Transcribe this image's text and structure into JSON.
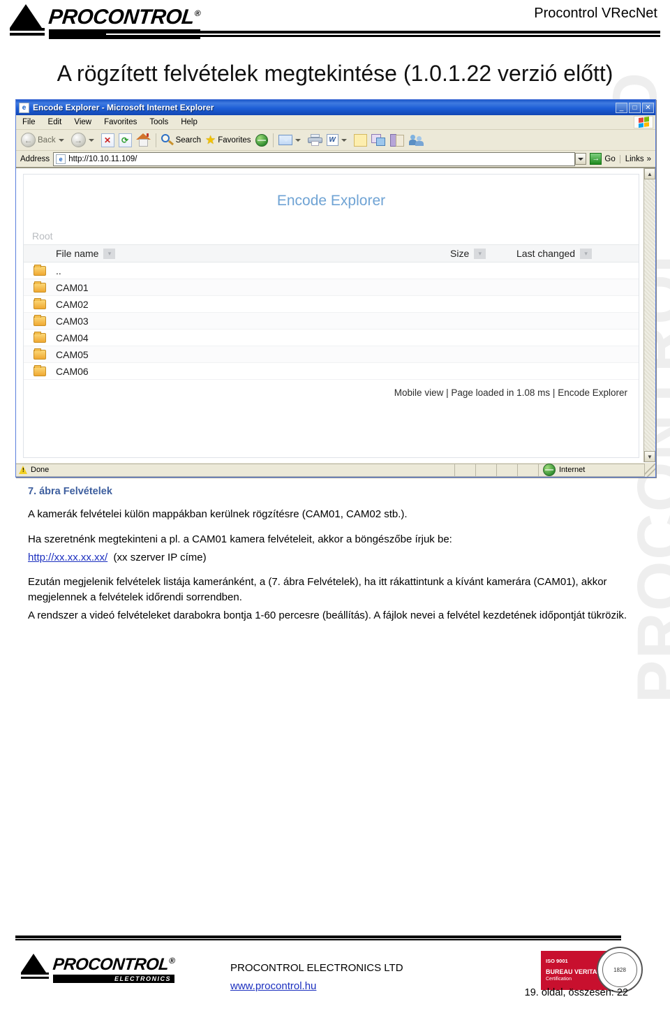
{
  "header": {
    "brand": "PROCONTROL",
    "brand_reg": "®",
    "brand_sub": "ELECTRONICS",
    "product": "Procontrol VRecNet"
  },
  "watermark": {
    "main": "PROCONTROL",
    "top": "LTD"
  },
  "document": {
    "title": "A rögzített felvételek megtekintése (1.0.1.22 verzió előtt)"
  },
  "browser": {
    "title": "Encode Explorer - Microsoft Internet Explorer",
    "window_icon": "ie-icon",
    "window_buttons": {
      "minimize": "_",
      "maximize": "□",
      "close": "✕"
    },
    "menu": [
      "File",
      "Edit",
      "View",
      "Favorites",
      "Tools",
      "Help"
    ],
    "toolbar": {
      "back": "Back",
      "forward": "",
      "stop": "✕",
      "refresh": "⟳",
      "home": "",
      "search": "Search",
      "favorites": "Favorites",
      "media": ""
    },
    "address": {
      "label": "Address",
      "url": "http://10.10.11.109/",
      "go": "Go",
      "links": "Links",
      "links_chevron": "»"
    },
    "status": {
      "text": "Done",
      "zone": "Internet"
    }
  },
  "encode_explorer": {
    "title": "Encode Explorer",
    "breadcrumb": "Root",
    "columns": {
      "name": "File name",
      "size": "Size",
      "changed": "Last changed"
    },
    "sort_glyph": "▾",
    "rows": [
      {
        "name": "..",
        "icon": "folder-icon"
      },
      {
        "name": "CAM01",
        "icon": "folder-icon"
      },
      {
        "name": "CAM02",
        "icon": "folder-icon"
      },
      {
        "name": "CAM03",
        "icon": "folder-icon"
      },
      {
        "name": "CAM04",
        "icon": "folder-icon"
      },
      {
        "name": "CAM05",
        "icon": "folder-icon"
      },
      {
        "name": "CAM06",
        "icon": "folder-icon"
      }
    ],
    "footer": "Mobile view | Page loaded in 1.08 ms | Encode Explorer"
  },
  "content": {
    "figure_caption": "7. ábra Felvételek",
    "p1": "A kamerák felvételei külön mappákban kerülnek rögzítésre (CAM01, CAM02 stb.).",
    "p2": "Ha szeretnénk megtekinteni a pl. a CAM01 kamera felvételeit, akkor a böngészőbe írjuk be:",
    "p2_link": "http://xx.xx.xx.xx/",
    "p2_tail": "(xx szerver IP címe)",
    "p3": "Ezután megjelenik felvételek listája kameránként, a (7. ábra Felvételek), ha itt rákattintunk a kívánt kamerára (CAM01), akkor megjelennek a felvételek időrendi sorrendben.",
    "p4": "A rendszer a videó felvételeket darabokra bontja 1-60 percesre (beállítás). A fájlok nevei a felvétel kezdetének időpontját tükrözik."
  },
  "footer": {
    "company": "PROCONTROL ELECTRONICS LTD",
    "website": "www.procontrol.hu",
    "page_number": "19. oldal, összesen: 22",
    "iso": {
      "line1": "ISO 9001",
      "line2": "BUREAU VERITAS",
      "line3": "Certification",
      "seal_top": "BUREAU VERITAS",
      "seal_year": "1828"
    }
  },
  "colors": {
    "accent_blue": "#6fa3d4",
    "caption_blue": "#3d5e9e",
    "link_blue": "#1b2fbf",
    "iso_red": "#c8102e",
    "titlebar_blue": "#1d5ed6"
  }
}
